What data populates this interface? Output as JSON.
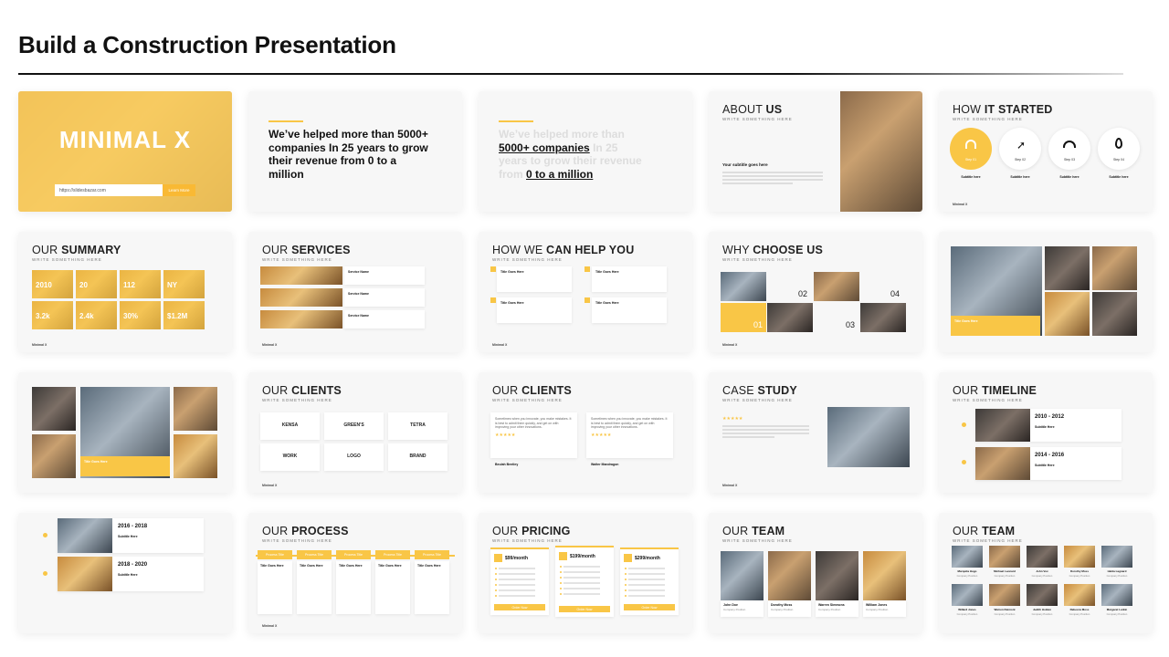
{
  "title": "Build a Construction Presentation",
  "slides": {
    "cover": {
      "title": "MINIMAL X",
      "input_value": "https://slidesbazar.com",
      "button": "Learn More"
    },
    "stats_dark": {
      "text": "We’ve helped more than 5000+ companies In 25 years to grow their revenue from 0 to a million"
    },
    "stats_light": {
      "line1": "We’ve helped more than",
      "highlight1": "5000+ companies",
      "line2": " In 25",
      "line3": "years to grow their revenue",
      "line4": "from ",
      "highlight2": "0 to a million"
    },
    "about": {
      "head_light": "ABOUT",
      "head_bold": "US",
      "sub": "WRITE SOMETHING HERE",
      "subtitle": "Your subtitle goes here"
    },
    "how_started": {
      "head_light": "HOW",
      "head_bold": "IT STARTED",
      "sub": "WRITE SOMETHING HERE",
      "steps": [
        "Step 01",
        "Step 02",
        "Step 03",
        "Step 04"
      ],
      "step_title": "Subtitle here"
    },
    "summary": {
      "head_light": "OUR",
      "head_bold": "SUMMARY",
      "sub": "WRITE SOMETHING HERE",
      "values": [
        "2010",
        "20",
        "112",
        "NY",
        "3.2k",
        "2.4k",
        "30%",
        "$1.2M"
      ]
    },
    "services": {
      "head_light": "OUR",
      "head_bold": "SERVICES",
      "sub": "WRITE SOMETHING HERE",
      "items": [
        "Service Name",
        "Service Name",
        "Service Name"
      ]
    },
    "help": {
      "head_light": "HOW WE",
      "head_bold": "CAN HELP YOU",
      "sub": "WRITE SOMETHING HERE",
      "item": "Title Goes Here"
    },
    "why": {
      "head_light": "WHY",
      "head_bold": "CHOOSE US",
      "sub": "WRITE SOMETHING HERE",
      "nums": [
        "01",
        "02",
        "03",
        "04"
      ]
    },
    "photos1": {
      "caption": "Title Goes Here"
    },
    "photos2": {
      "caption": "Title Goes Here"
    },
    "clients1": {
      "head_light": "OUR",
      "head_bold": "CLIENTS",
      "sub": "WRITE SOMETHING HERE",
      "logos": [
        "KENSA",
        "GREEN'S",
        "TETRA",
        "WORK",
        "LOGO",
        "BRAND"
      ]
    },
    "clients2": {
      "head_light": "OUR",
      "head_bold": "CLIENTS",
      "sub": "WRITE SOMETHING HERE",
      "quote": "Sometimes when you innovate, you make mistakes. It is best to admit them quickly, and get on with improving your other innovations.",
      "stars": "★★★★★",
      "names": [
        "Beulah Bentley",
        "Walter Mandragon"
      ]
    },
    "case": {
      "head_light": "CASE",
      "head_bold": "STUDY",
      "sub": "WRITE SOMETHING HERE",
      "stars": "★★★★★"
    },
    "timeline1": {
      "head_light": "OUR",
      "head_bold": "TIMELINE",
      "sub": "WRITE SOMETHING HERE",
      "periods": [
        "2010 - 2012",
        "2014 - 2016"
      ],
      "subtitle": "Subtitle Here"
    },
    "timeline2": {
      "periods": [
        "2016 - 2018",
        "2018 - 2020"
      ],
      "subtitle": "Subtitle Here"
    },
    "process": {
      "head_light": "OUR",
      "head_bold": "PROCESS",
      "sub": "WRITE SOMETHING HERE",
      "step": "Process Title",
      "item": "Title Goes Here"
    },
    "pricing": {
      "head_light": "OUR",
      "head_bold": "PRICING",
      "sub": "WRITE SOMETHING HERE",
      "prices": [
        "$99/month",
        "$199/month",
        "$299/month"
      ],
      "button": "Order Now"
    },
    "team1": {
      "head_light": "OUR",
      "head_bold": "TEAM",
      "sub": "WRITE SOMETHING HERE",
      "names": [
        "John Doe",
        "Dorothy Moss",
        "Warren Simmons",
        "William Jones"
      ],
      "position": "Company Position"
    },
    "team2": {
      "head_light": "OUR",
      "head_bold": "TEAM",
      "sub": "WRITE SOMETHING HERE",
      "names": [
        "Marquita Hugo",
        "Michael Leonard",
        "John Vox",
        "Dorothy Moss",
        "Helda Lagnard",
        "Willard Jones",
        "Warren Reimont",
        "Judith Holden",
        "Rebecca Moss",
        "Margaret Larkin"
      ],
      "position": "Company Position"
    },
    "footer": "Minimal X"
  }
}
